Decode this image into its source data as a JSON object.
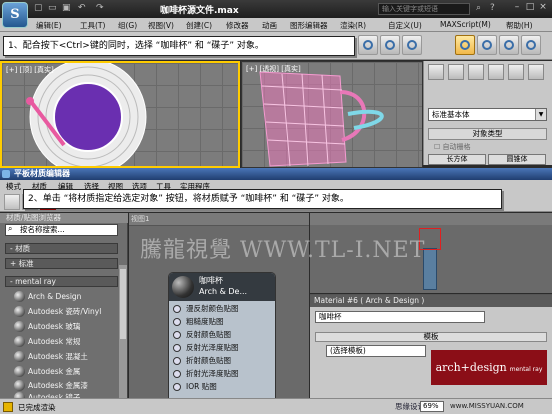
{
  "app": {
    "title": "咖啡杯源文件.max",
    "search_placeholder": "输入关键字或短语",
    "logo_glyph": "S"
  },
  "menu": [
    "编辑(E)",
    "工具(T)",
    "组(G)",
    "视图(V)",
    "创建(C)",
    "修改器",
    "动画",
    "图形编辑器",
    "渲染(R)",
    "自定义(U)",
    "MAXScript(M)",
    "帮助(H)"
  ],
  "viewports": {
    "top_label": "[+] [顶] [真实]",
    "persp_label": "[+] [透视] [真实]"
  },
  "command_panel": {
    "dropdown_value": "标准基本体",
    "rollout_title": "对象类型",
    "autogrid_label": "自动栅格",
    "button_box": "长方体",
    "button_cylinder": "圆锥体"
  },
  "callout1": "1、配合按下<Ctrl>键的同时，选择 “咖啡杯” 和 “碟子” 对象。",
  "callout2": "2、单击 “将材质指定给选定对象” 按钮，将材质赋予 “咖啡杯” 和 “碟子” 对象。",
  "material_editor": {
    "title": "平板材质编辑器",
    "menu": [
      "模式",
      "材质",
      "编辑",
      "选择",
      "视图",
      "选项",
      "工具",
      "实用程序"
    ],
    "browser_header": "材质/贴图浏览器",
    "search_placeholder": "按名称搜索...",
    "groups": [
      "- 材质",
      "+ 标准",
      "- mental ray"
    ],
    "materials": [
      "Arch & Design",
      "Autodesk 瓷砖/Vinyl",
      "Autodesk 玻璃",
      "Autodesk 常规",
      "Autodesk 混凝土",
      "Autodesk 金属",
      "Autodesk 金属漆",
      "Autodesk 镜子"
    ],
    "view_tab": "视图1",
    "node": {
      "name": "咖啡杯",
      "type": "Arch & De...",
      "slots": [
        "漫反射颜色贴图",
        "粗糙度贴图",
        "反射颜色贴图",
        "反射光泽度贴图",
        "折射颜色贴图",
        "折射光泽度贴图",
        "IOR 贴图"
      ]
    },
    "params_header": "Material #6  ( Arch & Design )",
    "material_name": "咖啡杯",
    "template_rollout": "模板",
    "template_value": "(选择模板)",
    "brand": "arch+design",
    "brand_sub": "mental ray",
    "status_text": "已完成渲染",
    "zoom": "69%"
  },
  "watermark": "騰龍視覺 WWW.TL-I.NET",
  "footer_cn": "思缘设计论坛",
  "footer_site": "www.MISSYUAN.COM",
  "colors": {
    "accent_yellow": "#ffcc00",
    "pink_mesh": "#e878b8",
    "cyan_mesh": "#7fd8e8",
    "purple_plate": "#6a2fb0",
    "brand_red": "#8b0e17",
    "highlight_red": "#cc0000"
  }
}
